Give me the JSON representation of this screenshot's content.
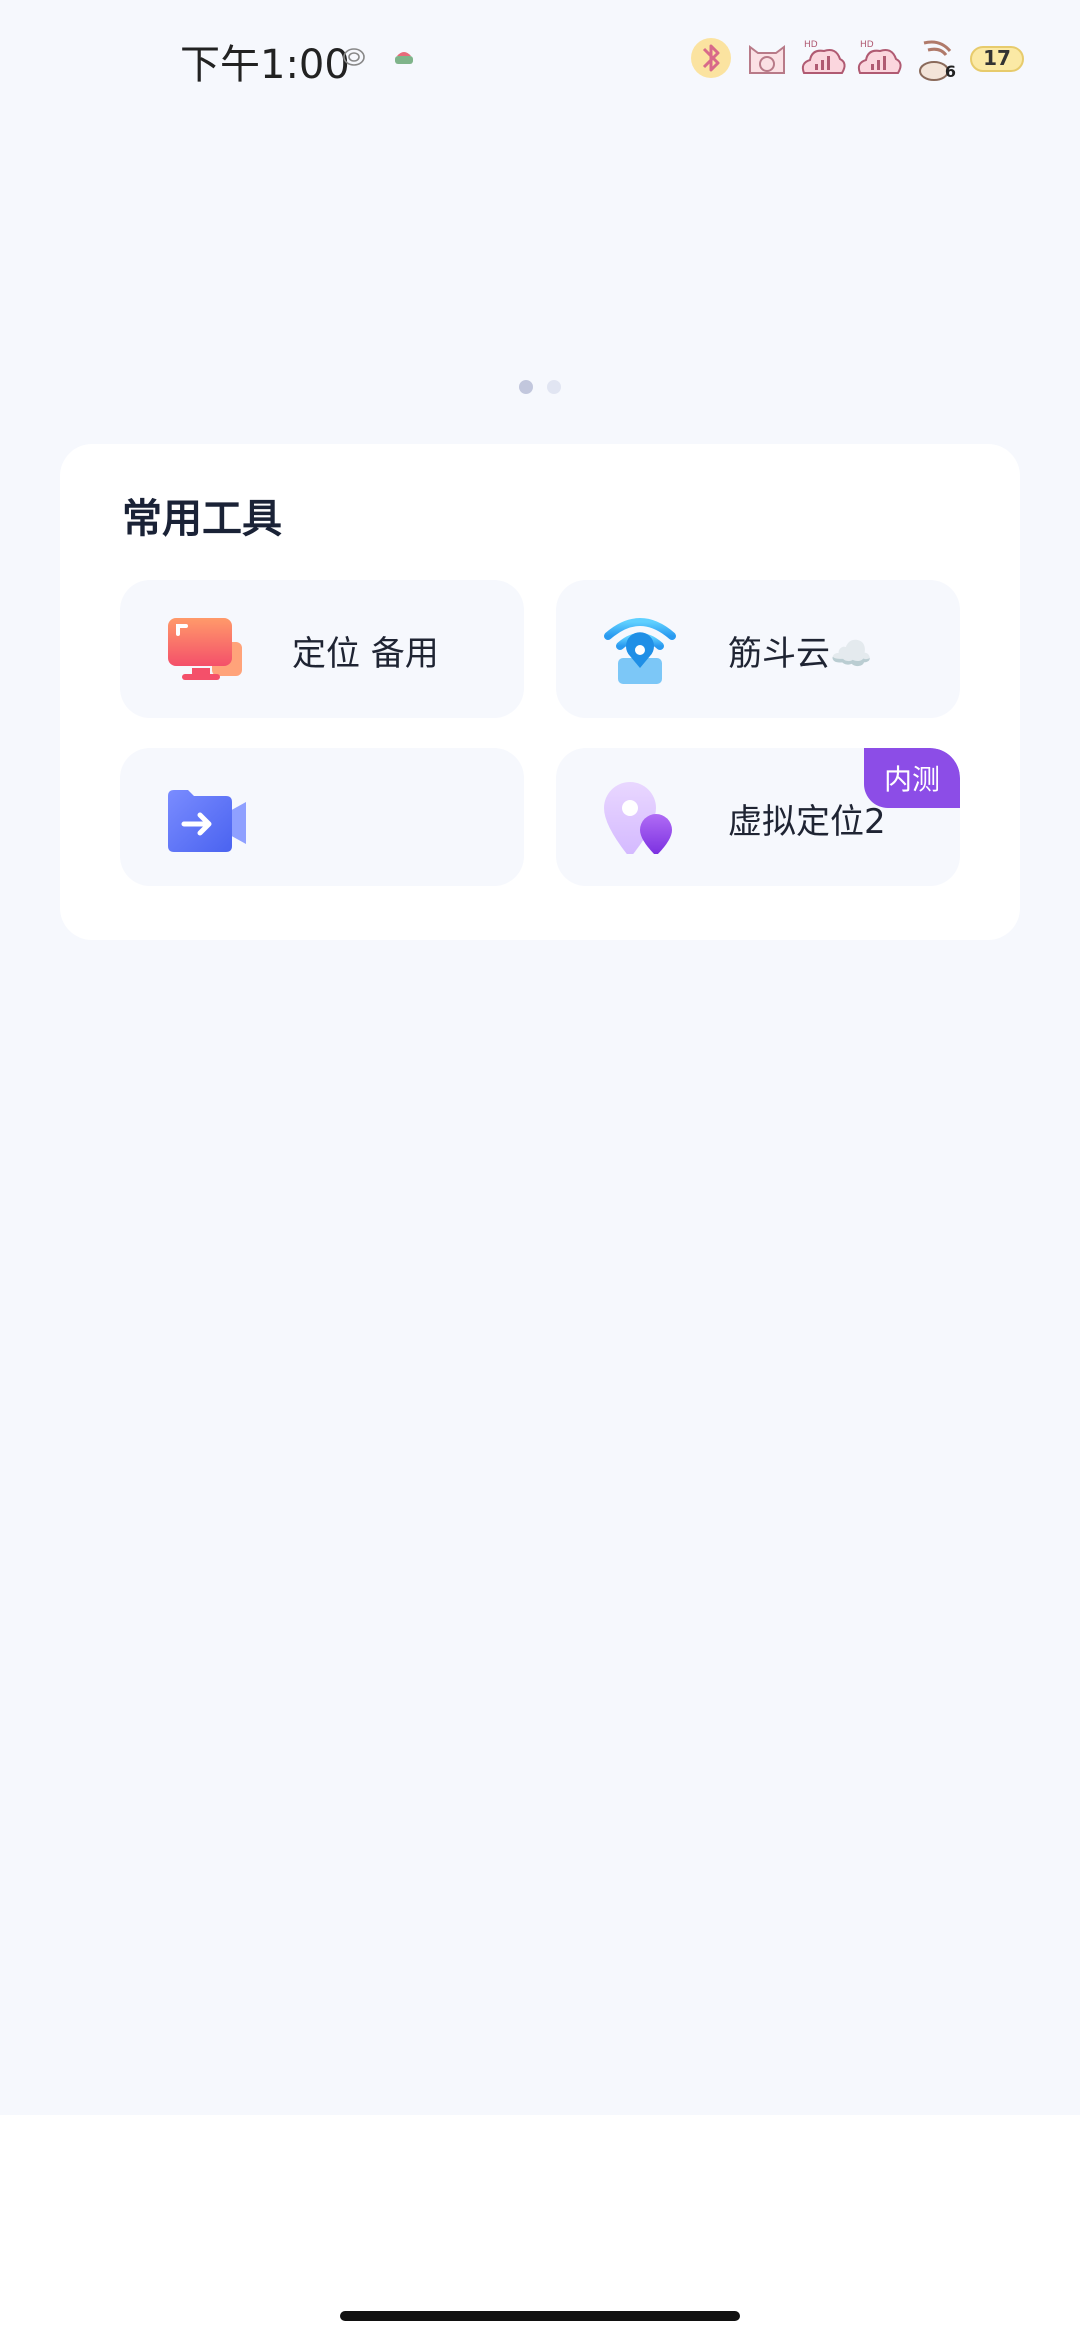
{
  "status_bar": {
    "time": "下午1:00",
    "battery_level": "17",
    "signal_sub": "6"
  },
  "carousel": {
    "page_count": 2,
    "active_index": 0
  },
  "tools_section": {
    "title": "常用工具",
    "items": [
      {
        "label": "定位 备用",
        "icon": "monitor-icon"
      },
      {
        "label": "筋斗云☁️",
        "icon": "wifi-cloud-icon"
      },
      {
        "label": "",
        "icon": "video-folder-icon"
      },
      {
        "label": "虚拟定位2",
        "icon": "location-pin-icon",
        "badge": "内测"
      }
    ]
  },
  "colors": {
    "background": "#f6f8fd",
    "card": "#ffffff",
    "badge": "#8c4de7",
    "title": "#1a2236"
  }
}
